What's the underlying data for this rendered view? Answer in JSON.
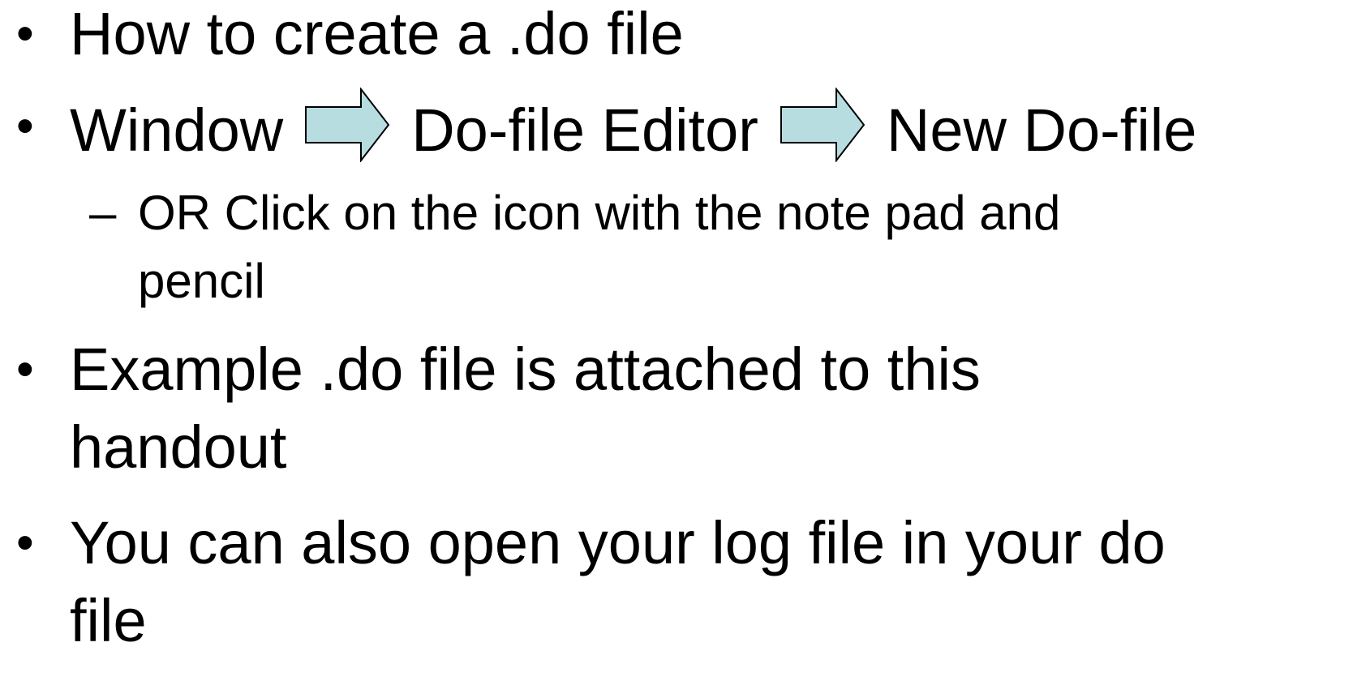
{
  "bullets": {
    "b1": {
      "text": "How to create a .do file"
    },
    "b2": {
      "step1": "Window",
      "step2": "Do-file Editor",
      "step3": "New Do-file",
      "arrow_icon": "right-arrow-icon",
      "arrow_fill": "#B7DDE1"
    },
    "b2_sub": {
      "dash": "–",
      "line1": "OR Click on the icon with the note pad and",
      "line2": "pencil"
    },
    "b3": {
      "line1": "Example .do file is attached to this",
      "line2": "handout"
    },
    "b4": {
      "line1": "You can also open your log file in your do",
      "line2": "file"
    }
  },
  "bullet_symbol": "•"
}
